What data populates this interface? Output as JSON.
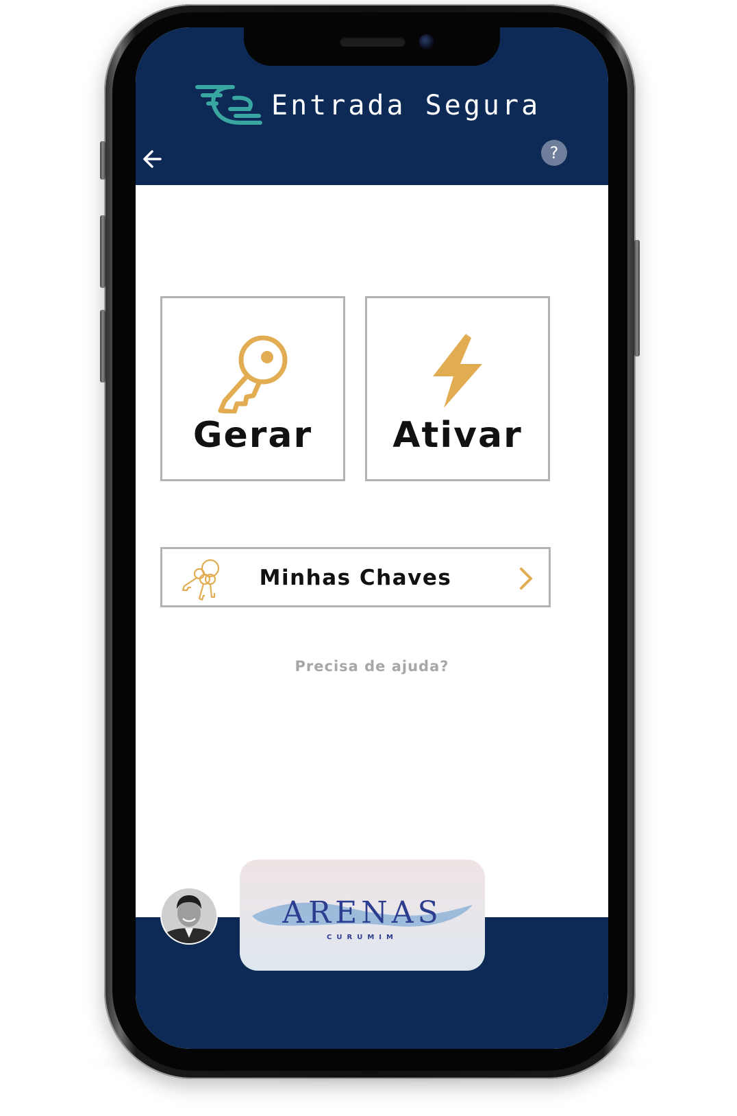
{
  "app": {
    "title": "Entrada Segura"
  },
  "colors": {
    "header_bg": "#0c2a55",
    "accent_gold": "#e2ac52",
    "logo_teal": "#3aa6a1",
    "tile_border": "#b3b3b3",
    "help_text": "#a7a7a7"
  },
  "header": {
    "back_icon": "arrow-left-icon",
    "help_label": "?"
  },
  "actions": [
    {
      "label": "Gerar",
      "icon": "key-icon"
    },
    {
      "label": "Ativar",
      "icon": "lightning-icon"
    }
  ],
  "my_keys": {
    "label": "Minhas Chaves",
    "icon": "keyring-icon",
    "chevron": "chevron-right-icon"
  },
  "help_link": "Precisa de ajuda?",
  "footer": {
    "brand_name": "ARENAS",
    "brand_sub": "CURUMIM"
  }
}
